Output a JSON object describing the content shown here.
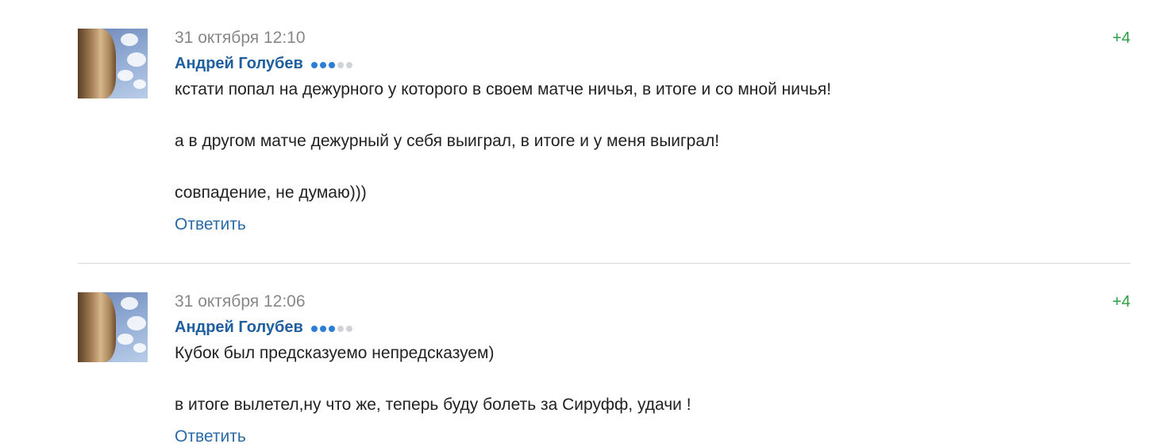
{
  "comments": [
    {
      "date": "31 октября 12:10",
      "author": "Андрей Голубев",
      "rating_dots": {
        "filled": 3,
        "total": 5
      },
      "paragraphs": [
        "кстати попал на дежурного у которого в своем матче ничья, в итоге и со мной ничья!",
        "а в другом матче дежурный у себя выиграл, в итоге и у меня выиграл!",
        "совпадение, не думаю)))"
      ],
      "reply_label": "Ответить",
      "score": "+4"
    },
    {
      "date": "31 октября 12:06",
      "author": "Андрей Голубев",
      "rating_dots": {
        "filled": 3,
        "total": 5
      },
      "paragraphs": [
        "Кубок был предсказуемо непредсказуем)",
        "в итоге вылетел,ну что же, теперь буду болеть за Сируфф, удачи !"
      ],
      "reply_label": "Ответить",
      "score": "+4"
    }
  ],
  "colors": {
    "author": "#1f5f9e",
    "reply": "#2a6aa8",
    "score": "#2e9e44",
    "date": "#888888",
    "dot_on": "#2b7ed6",
    "dot_off": "#d0d4d9"
  }
}
